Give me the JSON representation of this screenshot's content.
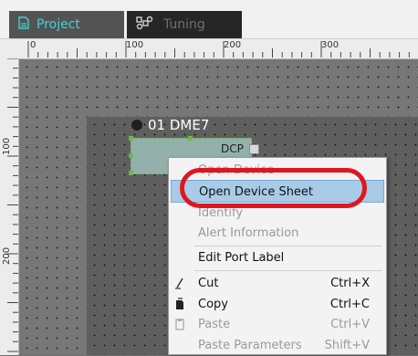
{
  "tabs": [
    {
      "label": "Project",
      "icon": "document-icon",
      "active": true
    },
    {
      "label": "Tuning",
      "icon": "sliders-icon",
      "active": false
    }
  ],
  "ruler": {
    "top_labels": [
      "0",
      "100",
      "200",
      "300"
    ],
    "left_labels": [
      "100",
      "200"
    ]
  },
  "device": {
    "title": "01 DME7",
    "dcp_label": "DCP"
  },
  "context_menu": {
    "items": [
      {
        "label": "Open Device",
        "enabled": false
      },
      {
        "label": "Open Device Sheet",
        "enabled": true,
        "highlighted": true
      },
      {
        "label": "Identify",
        "enabled": false
      },
      {
        "label": "Alert Information",
        "enabled": false
      },
      {
        "label": "Edit Port Label",
        "enabled": true
      },
      {
        "label": "Cut",
        "shortcut": "Ctrl+X",
        "enabled": true,
        "icon": "cut-icon"
      },
      {
        "label": "Copy",
        "shortcut": "Ctrl+C",
        "enabled": true,
        "icon": "copy-icon"
      },
      {
        "label": "Paste",
        "shortcut": "Ctrl+V",
        "enabled": false,
        "icon": "paste-icon"
      },
      {
        "label": "Paste Parameters",
        "shortcut": "Shift+V",
        "enabled": false
      }
    ]
  },
  "colors": {
    "tab_active_text": "#3fd3d8",
    "highlight": "#a9cbe8",
    "callout": "#e0161e"
  }
}
